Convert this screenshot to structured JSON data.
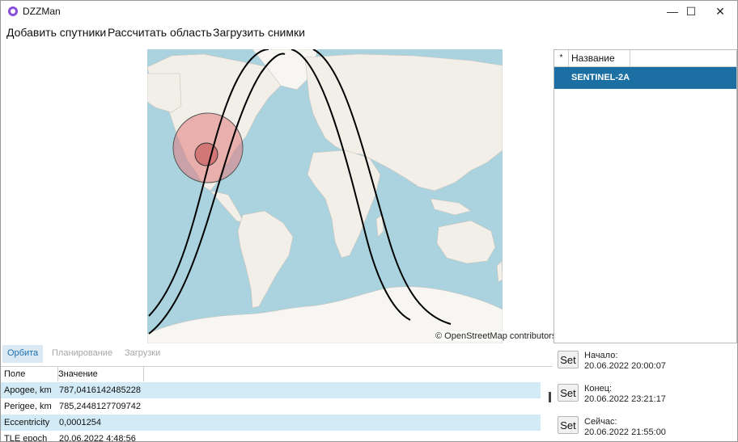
{
  "window": {
    "title": "DZZMan",
    "minimize_glyph": "—",
    "maximize_glyph": "☐",
    "close_glyph": "✕"
  },
  "menu": {
    "items": [
      "Добавить спутники",
      "Рассчитать область",
      "Загрузить снимки"
    ]
  },
  "map": {
    "attribution": "© OpenStreetMap contributors",
    "colors": {
      "water": "#aad3df",
      "land": "#f2efe9",
      "ice": "#f7f6f3",
      "track": "#000000",
      "coverage_outer": "#e08a8a",
      "coverage_inner": "#c05050"
    }
  },
  "satellites": {
    "header": {
      "star": "*",
      "name": "Название"
    },
    "rows": [
      {
        "name": "SENTINEL-2A",
        "selected": true
      }
    ],
    "selected_color": "#1c6fa3"
  },
  "tabs": [
    {
      "label": "Орбита",
      "active": true
    },
    {
      "label": "Планирование",
      "active": false
    },
    {
      "label": "Загрузки",
      "active": false
    }
  ],
  "grid": {
    "headers": {
      "field": "Поле",
      "value": "Значение"
    },
    "rows": [
      {
        "field": "Apogee, km",
        "value": "787,0416142485228"
      },
      {
        "field": "Perigee, km",
        "value": "785,2448127709742"
      },
      {
        "field": "Eccentricity",
        "value": "0,0001254"
      },
      {
        "field": "TLE epoch",
        "value": "20.06.2022 4:48:56"
      }
    ]
  },
  "time_controls": {
    "set_label": "Set",
    "start": {
      "label": "Начало:",
      "value": "20.06.2022 20:00:07"
    },
    "end": {
      "label": "Конец:",
      "value": "20.06.2022 23:21:17"
    },
    "now": {
      "label": "Сейчас:",
      "value": "20.06.2022 21:55:00"
    }
  }
}
